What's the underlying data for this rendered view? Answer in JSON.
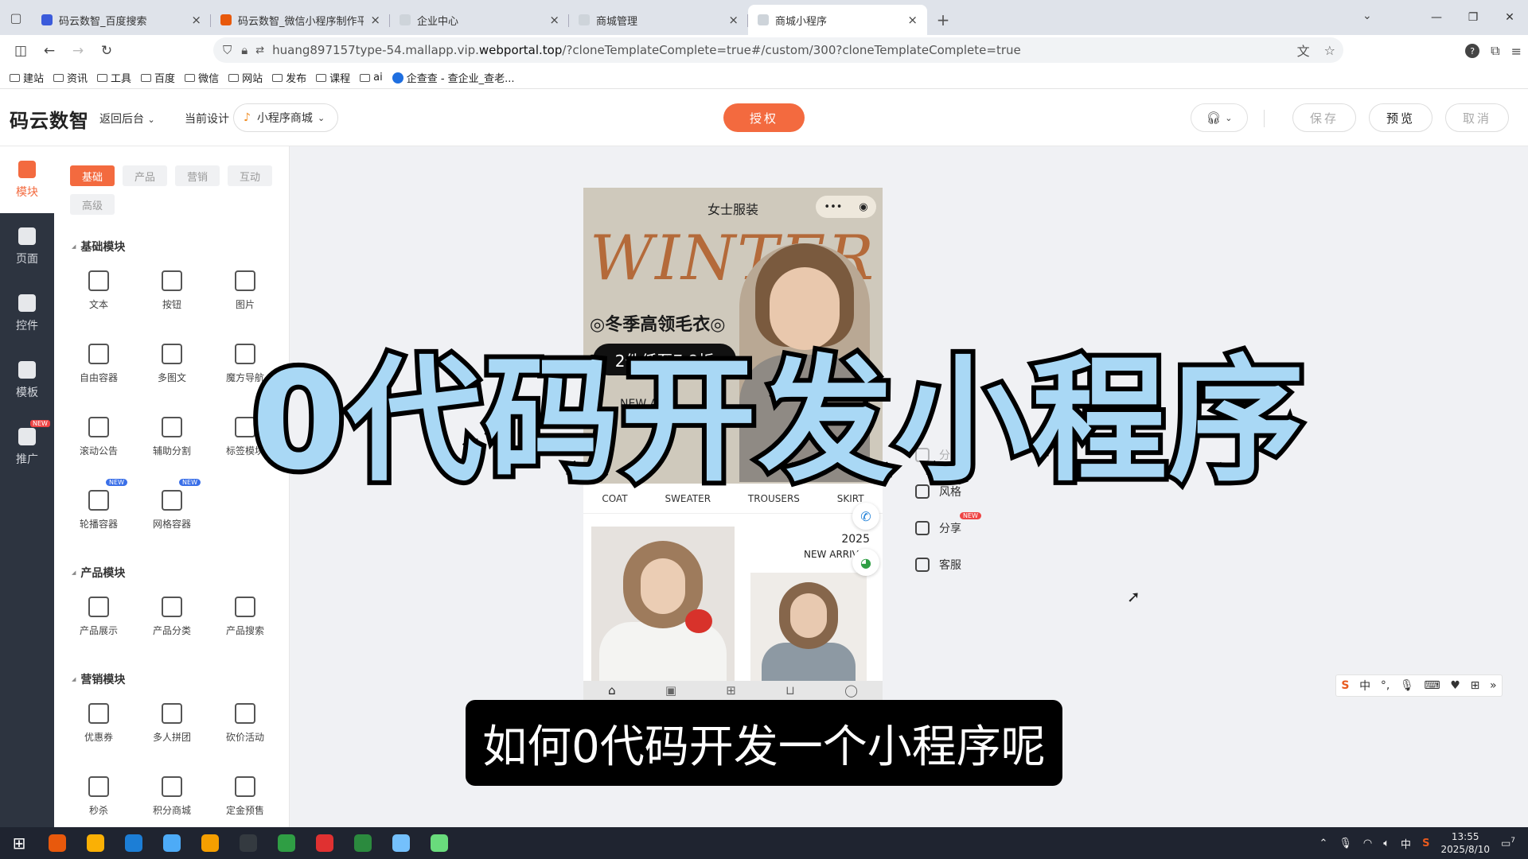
{
  "browser": {
    "tabs": [
      {
        "title": "码云数智_百度搜索",
        "favcolor": "#3b5bdb"
      },
      {
        "title": "码云数智_微信小程序制作平台_",
        "favcolor": "#e8590c"
      },
      {
        "title": "企业中心",
        "favcolor": "#ced4da"
      },
      {
        "title": "商城管理",
        "favcolor": "#ced4da"
      },
      {
        "title": "商城小程序",
        "favcolor": "#ced4da"
      }
    ],
    "url_prefix": "huang897157type-54.mallapp.vip.",
    "url_domain": "webportal.top",
    "url_rest": "/?cloneTemplateComplete=true#/custom/300?cloneTemplateComplete=true",
    "bookmarks": [
      "建站",
      "资讯",
      "工具",
      "百度",
      "微信",
      "网站",
      "发布",
      "课程",
      "ai"
    ],
    "bookmark_special": "企查查 - 查企业_查老..."
  },
  "app": {
    "logo": "码云数智",
    "back_label": "返回后台",
    "current_design_label": "当前设计",
    "design_select": "小程序商城",
    "auth_button": "授权",
    "save_button": "保存",
    "preview_button": "预览",
    "cancel_button": "取消"
  },
  "rail": [
    {
      "label": "模块",
      "active": true
    },
    {
      "label": "页面",
      "active": false
    },
    {
      "label": "控件",
      "active": false
    },
    {
      "label": "模板",
      "active": false
    },
    {
      "label": "推广",
      "active": false,
      "badge": "NEW"
    }
  ],
  "panel": {
    "tabs": [
      "基础",
      "产品",
      "营销",
      "互动",
      "高级"
    ],
    "sections": [
      {
        "title": "基础模块",
        "items": [
          {
            "label": "文本"
          },
          {
            "label": "按钮"
          },
          {
            "label": "图片"
          },
          {
            "label": "自由容器"
          },
          {
            "label": "多图文"
          },
          {
            "label": "魔方导航"
          },
          {
            "label": "滚动公告"
          },
          {
            "label": "辅助分割"
          },
          {
            "label": "标签模块"
          },
          {
            "label": "轮播容器",
            "badge": "NEW"
          },
          {
            "label": "网格容器",
            "badge": "NEW"
          }
        ]
      },
      {
        "title": "产品模块",
        "items": [
          {
            "label": "产品展示"
          },
          {
            "label": "产品分类"
          },
          {
            "label": "产品搜索"
          }
        ]
      },
      {
        "title": "营销模块",
        "items": [
          {
            "label": "优惠券"
          },
          {
            "label": "多人拼团"
          },
          {
            "label": "砍价活动"
          },
          {
            "label": "秒杀"
          },
          {
            "label": "积分商城"
          },
          {
            "label": "定金预售"
          }
        ]
      }
    ]
  },
  "phone": {
    "title": "女士服装",
    "capsule_more": "•••",
    "capsule_close": "◉",
    "banner_word": "WINTER",
    "headline": "◎冬季高领毛衣◎",
    "promo": "2件低至7.8折",
    "new_arrival_partial": "NEW ARR",
    "categories": [
      "COAT",
      "SWEATER",
      "TROUSERS",
      "SKIRT"
    ],
    "year": "2025",
    "new_arrival": "NEW ARRIVAL"
  },
  "quick_list": [
    {
      "label": "分销"
    },
    {
      "label": "风格"
    },
    {
      "label": "分享",
      "badge": "NEW"
    },
    {
      "label": "客服"
    }
  ],
  "overlay": {
    "big_title": "0代码开发小程序",
    "subtitle": "如何0代码开发一个小程序呢"
  },
  "ime": {
    "lang": "中"
  },
  "taskbar": {
    "time": "13:55",
    "date": "2025/8/10",
    "ime": "中",
    "notifications": "7",
    "apps": [
      "#e8590c",
      "#fab005",
      "#1c7ed6",
      "#4dabf7",
      "#f59f00",
      "#343a40",
      "#2f9e44",
      "#e03131",
      "#2b8a3e",
      "#74c0fc",
      "#69db7c"
    ]
  }
}
